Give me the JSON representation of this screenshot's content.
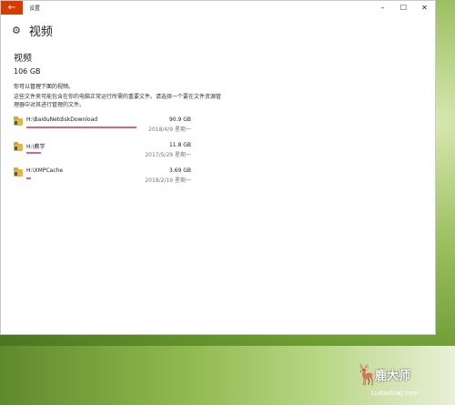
{
  "window": {
    "title": "设置",
    "back_icon": "back-arrow-icon",
    "controls": {
      "minimize": "–",
      "maximize": "☐",
      "close": "✕"
    }
  },
  "header": {
    "icon": "gear-icon",
    "title": "视频"
  },
  "page": {
    "section_title": "视频",
    "total_size": "106 GB",
    "description_short": "你可以管理下面的视频。",
    "description_long": "这些文件夹可能包含在你的电脑正常运行所需的重要文件。请选择一个要在文件资源管理器中对其进行管理的文件。"
  },
  "folders": [
    {
      "path": "H:\\BaiduNetdiskDownload",
      "size": "90.9 GB",
      "date": "2018/4/9 星期一",
      "fraction": 1.0
    },
    {
      "path": "H:\\教学",
      "size": "11.8 GB",
      "date": "2017/5/29 星期一",
      "fraction": 0.13
    },
    {
      "path": "H:\\XMPCache",
      "size": "3.69 GB",
      "date": "2018/2/19 星期一",
      "fraction": 0.04
    }
  ],
  "colors": {
    "accent": "#d83b01",
    "usage_bar": "#d4658f",
    "folder": "#e8b640"
  },
  "watermark": {
    "brand": "鹿大师",
    "url": "Ludashiwj.com"
  }
}
